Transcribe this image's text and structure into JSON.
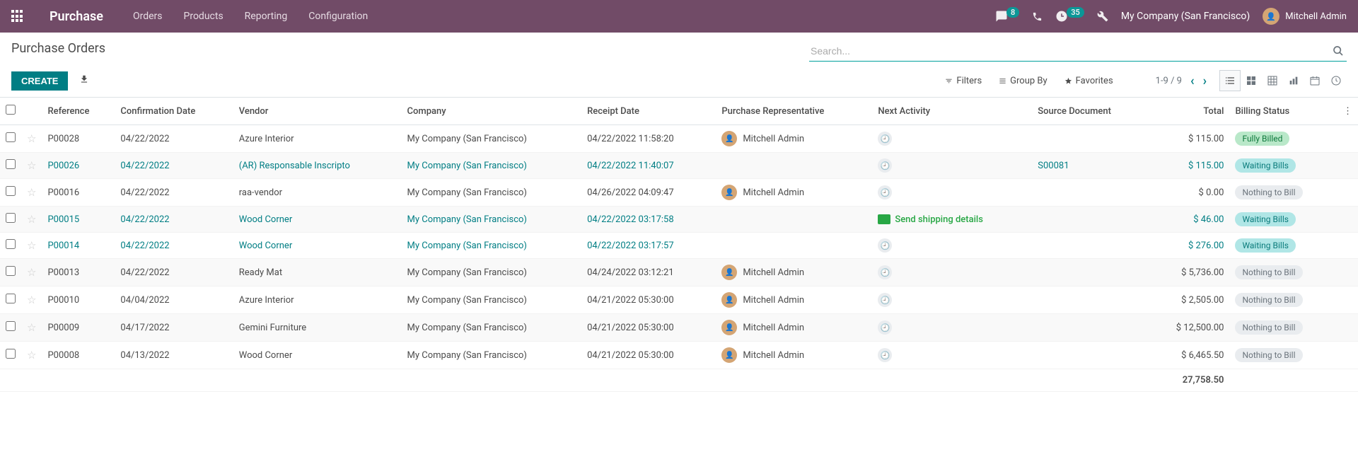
{
  "topbar": {
    "app": "Purchase",
    "menus": [
      "Orders",
      "Products",
      "Reporting",
      "Configuration"
    ],
    "chat_badge": "8",
    "activity_badge": "35",
    "company": "My Company (San Francisco)",
    "user": "Mitchell Admin"
  },
  "cp": {
    "breadcrumb": "Purchase Orders",
    "search_placeholder": "Search...",
    "create": "CREATE",
    "filters": "Filters",
    "groupby": "Group By",
    "favorites": "Favorites",
    "pager": "1-9 / 9"
  },
  "columns": {
    "reference": "Reference",
    "confirmation_date": "Confirmation Date",
    "vendor": "Vendor",
    "company": "Company",
    "receipt_date": "Receipt Date",
    "rep": "Purchase Representative",
    "next_activity": "Next Activity",
    "source": "Source Document",
    "total": "Total",
    "billing": "Billing Status"
  },
  "rows": [
    {
      "ref": "P00028",
      "confirm": "04/22/2022",
      "vendor": "Azure Interior",
      "company": "My Company (San Francisco)",
      "receipt": "04/22/2022 11:58:20",
      "rep": "Mitchell Admin",
      "has_rep": true,
      "activity": "",
      "activity_type": "clock",
      "source": "",
      "total": "$ 115.00",
      "status": "Fully Billed",
      "status_cls": "pill-green",
      "link": false
    },
    {
      "ref": "P00026",
      "confirm": "04/22/2022",
      "vendor": "(AR) Responsable Inscripto",
      "company": "My Company (San Francisco)",
      "receipt": "04/22/2022 11:40:07",
      "rep": "",
      "has_rep": false,
      "activity": "",
      "activity_type": "clock",
      "source": "S00081",
      "total": "$ 115.00",
      "status": "Waiting Bills",
      "status_cls": "pill-teal",
      "link": true
    },
    {
      "ref": "P00016",
      "confirm": "04/22/2022",
      "vendor": "raa-vendor",
      "company": "My Company (San Francisco)",
      "receipt": "04/26/2022 04:09:47",
      "rep": "Mitchell Admin",
      "has_rep": true,
      "activity": "",
      "activity_type": "clock",
      "source": "",
      "total": "$ 0.00",
      "status": "Nothing to Bill",
      "status_cls": "pill-gray",
      "link": false
    },
    {
      "ref": "P00015",
      "confirm": "04/22/2022",
      "vendor": "Wood Corner",
      "company": "My Company (San Francisco)",
      "receipt": "04/22/2022 03:17:58",
      "rep": "",
      "has_rep": false,
      "activity": "Send shipping details",
      "activity_type": "planned",
      "source": "",
      "total": "$ 46.00",
      "status": "Waiting Bills",
      "status_cls": "pill-teal",
      "link": true
    },
    {
      "ref": "P00014",
      "confirm": "04/22/2022",
      "vendor": "Wood Corner",
      "company": "My Company (San Francisco)",
      "receipt": "04/22/2022 03:17:57",
      "rep": "",
      "has_rep": false,
      "activity": "",
      "activity_type": "clock",
      "source": "",
      "total": "$ 276.00",
      "status": "Waiting Bills",
      "status_cls": "pill-teal",
      "link": true
    },
    {
      "ref": "P00013",
      "confirm": "04/22/2022",
      "vendor": "Ready Mat",
      "company": "My Company (San Francisco)",
      "receipt": "04/24/2022 03:12:21",
      "rep": "Mitchell Admin",
      "has_rep": true,
      "activity": "",
      "activity_type": "clock",
      "source": "",
      "total": "$ 5,736.00",
      "status": "Nothing to Bill",
      "status_cls": "pill-gray",
      "link": false
    },
    {
      "ref": "P00010",
      "confirm": "04/04/2022",
      "vendor": "Azure Interior",
      "company": "My Company (San Francisco)",
      "receipt": "04/21/2022 05:30:00",
      "rep": "Mitchell Admin",
      "has_rep": true,
      "activity": "",
      "activity_type": "clock",
      "source": "",
      "total": "$ 2,505.00",
      "status": "Nothing to Bill",
      "status_cls": "pill-gray",
      "link": false
    },
    {
      "ref": "P00009",
      "confirm": "04/17/2022",
      "vendor": "Gemini Furniture",
      "company": "My Company (San Francisco)",
      "receipt": "04/21/2022 05:30:00",
      "rep": "Mitchell Admin",
      "has_rep": true,
      "activity": "",
      "activity_type": "clock",
      "source": "",
      "total": "$ 12,500.00",
      "status": "Nothing to Bill",
      "status_cls": "pill-gray",
      "link": false
    },
    {
      "ref": "P00008",
      "confirm": "04/13/2022",
      "vendor": "Wood Corner",
      "company": "My Company (San Francisco)",
      "receipt": "04/21/2022 05:30:00",
      "rep": "Mitchell Admin",
      "has_rep": true,
      "activity": "",
      "activity_type": "clock",
      "source": "",
      "total": "$ 6,465.50",
      "status": "Nothing to Bill",
      "status_cls": "pill-gray",
      "link": false
    }
  ],
  "footer_total": "27,758.50"
}
